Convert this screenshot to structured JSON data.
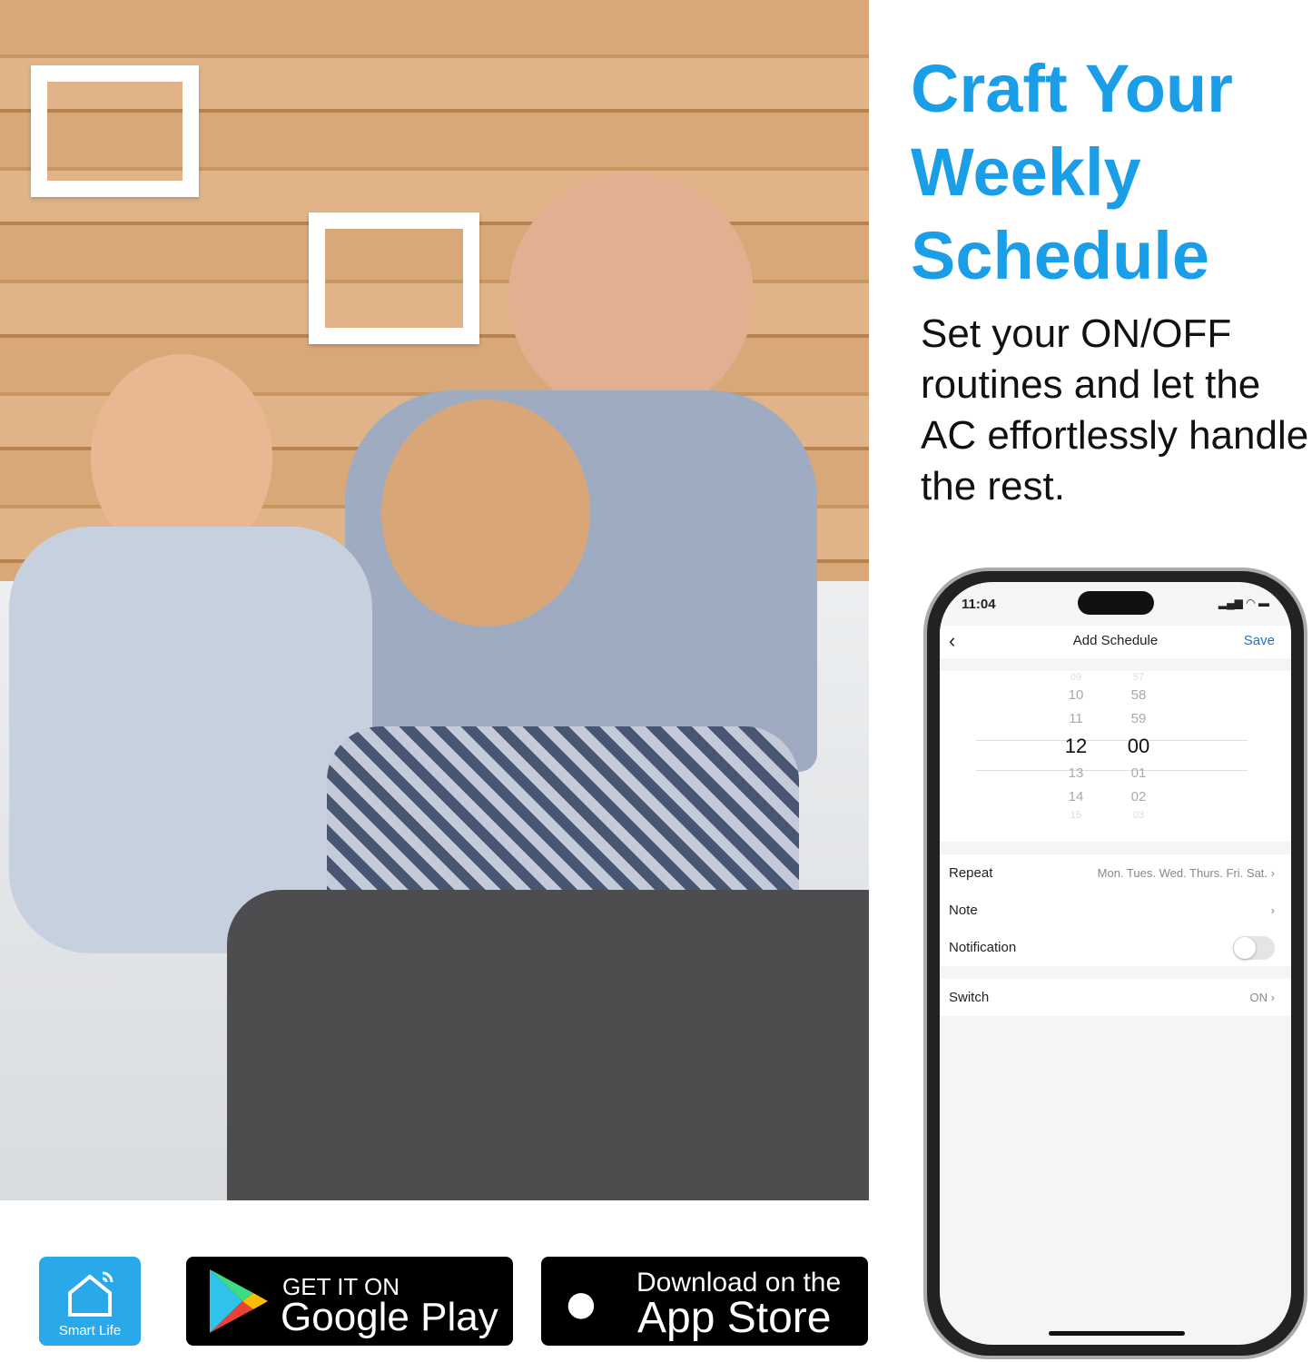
{
  "headline": {
    "line1": "Craft Your",
    "line2": "Weekly",
    "line3": "Schedule"
  },
  "subtext": "Set your ON/OFF routines and let the AC effortlessly handle the rest.",
  "colors": {
    "accent": "#1b9ee8",
    "smart_life": "#29a9ea",
    "save_link": "#1a73c8"
  },
  "phone": {
    "time": "11:04",
    "title": "Add Schedule",
    "save": "Save",
    "picker": {
      "hours": [
        "09",
        "10",
        "11",
        "12",
        "13",
        "14",
        "15"
      ],
      "minutes": [
        "57",
        "58",
        "59",
        "00",
        "01",
        "02",
        "03"
      ]
    },
    "rows": [
      {
        "label": "Repeat",
        "value": "Mon. Tues. Wed. Thurs. Fri. Sat."
      },
      {
        "label": "Note",
        "value": ""
      },
      {
        "label": "Notification",
        "toggle": false
      },
      {
        "label": "Switch",
        "value": "ON"
      }
    ]
  },
  "badges": {
    "smart_life": "Smart Life",
    "google_top": "GET IT ON",
    "google_main": "Google Play",
    "apple_top": "Download on the",
    "apple_main": "App Store"
  }
}
